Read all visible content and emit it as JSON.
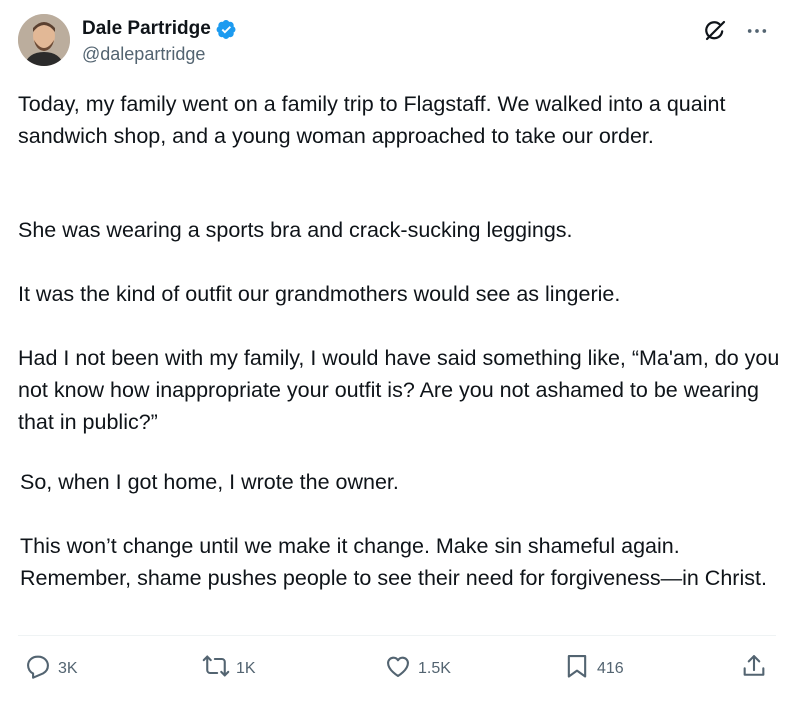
{
  "author": {
    "display_name": "Dale Partridge",
    "handle": "@dalepartridge",
    "verified_icon": "verified-badge-icon",
    "verified_color": "#1d9bf0"
  },
  "top_actions": {
    "grok_icon": "grok-icon",
    "more_icon": "more-horizontal-icon"
  },
  "tweet": {
    "paragraphs": [
      "Today, my family went on a family trip to Flagstaff. We walked into a quaint sandwich shop, and a young woman approached to take our order.",
      "She was wearing a sports bra and crack-sucking leggings.",
      "It was the kind of outfit our grandmothers would see as lingerie.",
      "Had I not been with my family, I would have said something like, “Ma'am, do you not know how inappropriate your outfit is? Are you not ashamed to be wearing that in public?”",
      "So, when I got home, I wrote the owner.",
      "This won’t change until we make it change. Make sin shameful again. Remember, shame pushes people to see their need for forgiveness—in Christ."
    ]
  },
  "actions": {
    "reply": {
      "icon": "reply-icon",
      "count": "3K"
    },
    "repost": {
      "icon": "repost-icon",
      "count": "1K"
    },
    "like": {
      "icon": "heart-icon",
      "count": "1.5K"
    },
    "bookmark": {
      "icon": "bookmark-icon",
      "count": "416"
    },
    "share": {
      "icon": "share-icon"
    }
  },
  "colors": {
    "text": "#0f1419",
    "secondary": "#536471",
    "divider": "#eff3f4"
  }
}
